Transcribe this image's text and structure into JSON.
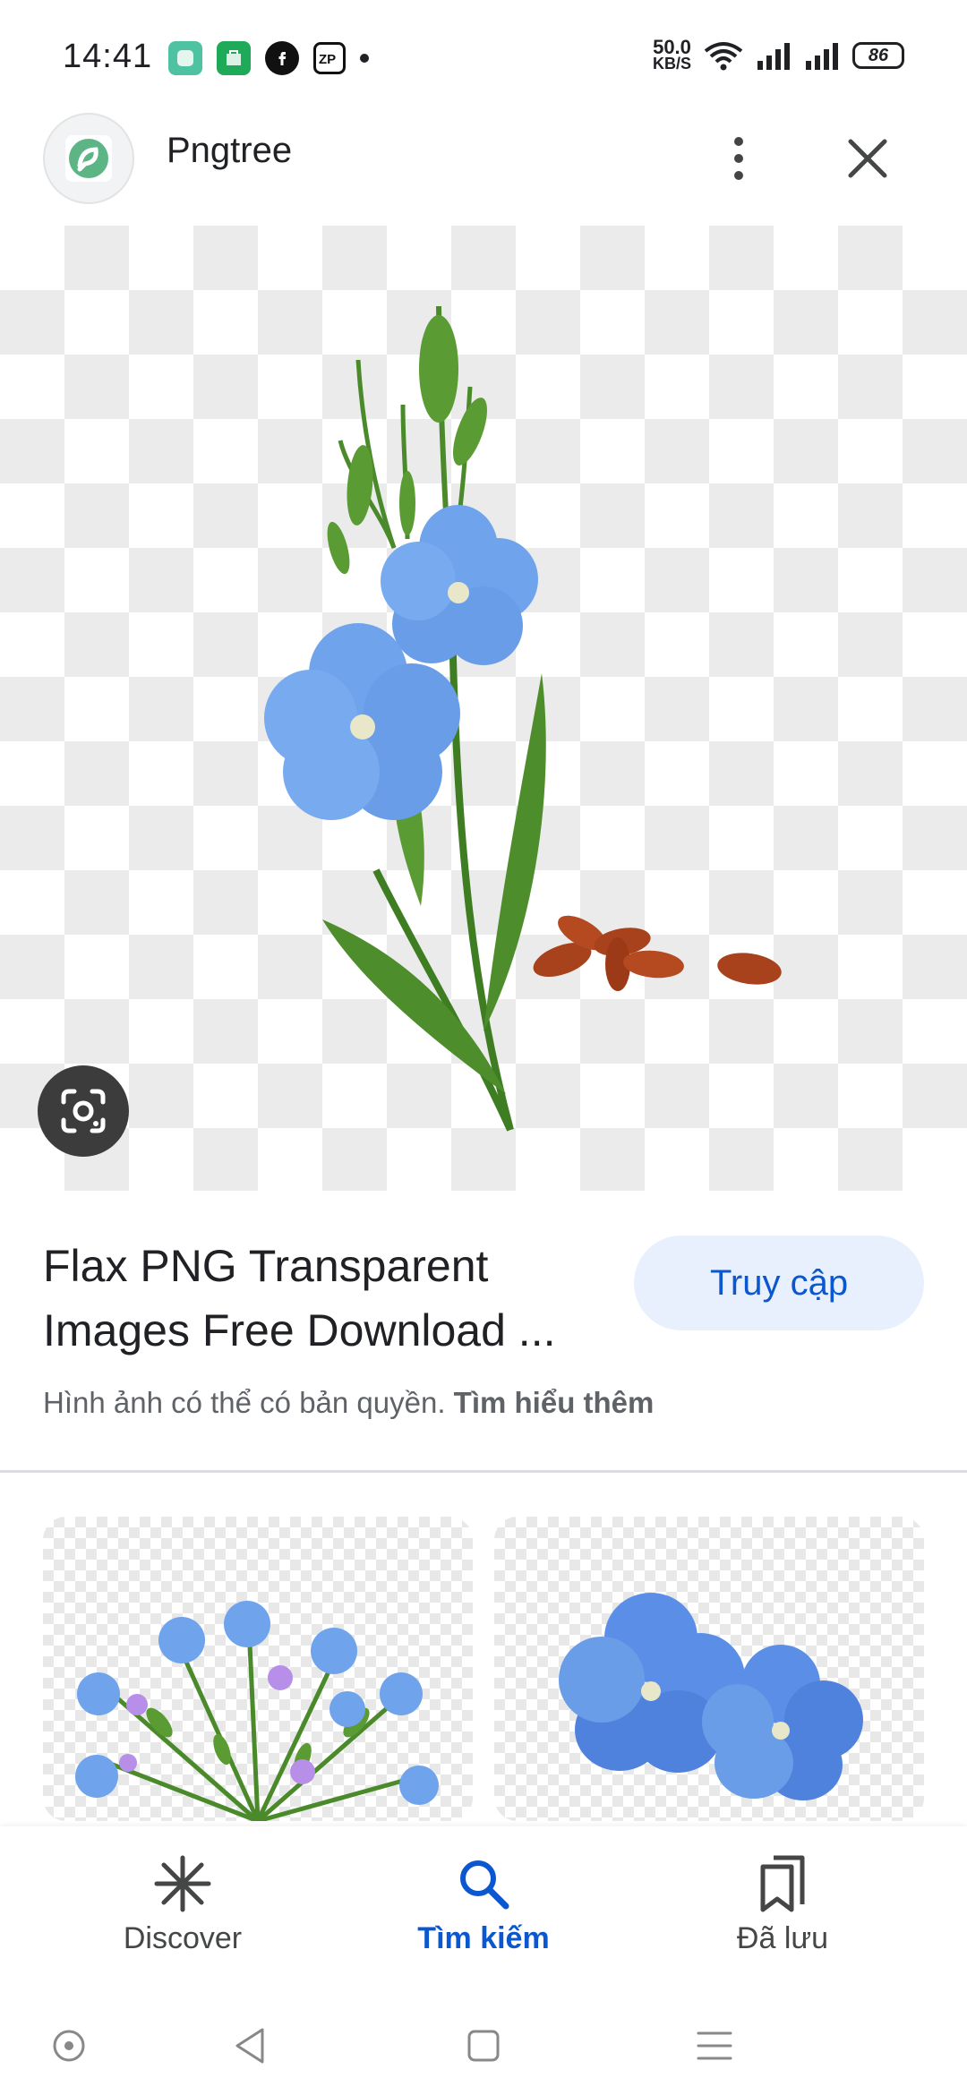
{
  "status_bar": {
    "time": "14:41",
    "net_speed_value": "50.0",
    "net_speed_unit": "KB/S",
    "battery": "86",
    "app_icons": [
      "app-green-square-icon",
      "app-green-store-icon",
      "facebook-icon",
      "zalopay-icon",
      "dot-icon"
    ],
    "right_icons": [
      "wifi-icon",
      "signal-icon",
      "signal-icon"
    ]
  },
  "header": {
    "site_name": "Pngtree",
    "logo_icon": "pngtree-logo-icon",
    "more_icon": "more-vert-icon",
    "close_icon": "close-icon"
  },
  "image": {
    "lens_icon": "google-lens-icon"
  },
  "info": {
    "title": "Flax PNG Transparent Images Free Download ...",
    "visit_label": "Truy cập",
    "copyright_text": "Hình ảnh có thể có bản quyền. ",
    "learn_more": "Tìm hiểu thêm"
  },
  "bottom_nav": {
    "items": [
      {
        "label": "Discover",
        "icon": "asterisk-icon",
        "active": false
      },
      {
        "label": "Tìm kiếm",
        "icon": "search-icon",
        "active": true
      },
      {
        "label": "Đã lưu",
        "icon": "bookmarks-icon",
        "active": false
      }
    ]
  },
  "system_nav": {
    "icons": [
      "assistant-dot-icon",
      "back-icon",
      "home-icon",
      "menu-icon"
    ]
  },
  "colors": {
    "accent": "#0b57d0",
    "visit_bg": "#e8f0fd",
    "flower_blue": "#6fa3ec",
    "leaf_green": "#4a8a2a",
    "seed_brown": "#a8421c"
  }
}
